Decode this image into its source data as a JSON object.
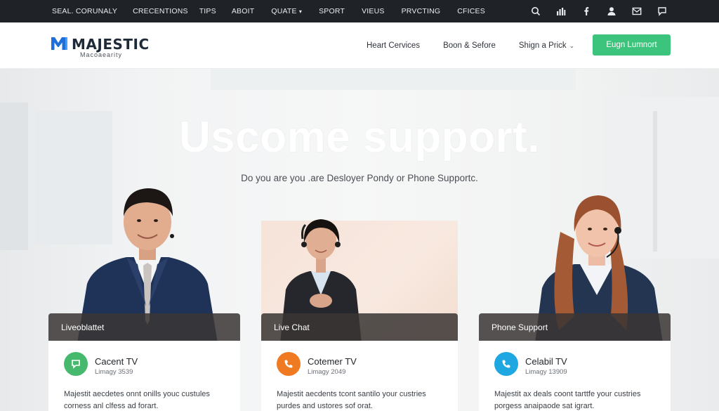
{
  "topbar": {
    "nav": [
      "SEAL. CORUNALY",
      "CRECENTIONS",
      "TIPS",
      "ABOIT",
      "QUATE",
      "SPORT",
      "VIEUS",
      "PRVCTING",
      "CFICES"
    ],
    "dropdown_item": "QUATE",
    "icons": [
      "search-icon",
      "bar-chart-icon",
      "facebook-icon",
      "user-icon",
      "mail-icon",
      "chat-icon"
    ]
  },
  "header": {
    "logo_word": "MAJESTIC",
    "logo_sub": "Macoaearity",
    "nav": [
      {
        "label": "Heart Cervices",
        "dropdown": false
      },
      {
        "label": "Boon & Sefore",
        "dropdown": false
      },
      {
        "label": "Shign a Prick",
        "dropdown": true
      }
    ],
    "cta_label": "Eugn Lumnort"
  },
  "hero": {
    "title": "Uscome support.",
    "subtitle": "Do you are you .are Desloyer Pondy or Phone Supportc."
  },
  "cards": [
    {
      "header": "Liveoblattet",
      "title": "Cacent TV",
      "meta": "Limagy 3539",
      "desc": "Majestit aecdetes onnt onills youc custules corness anl clfess ad forart.",
      "icon": "chat-bubble-icon",
      "color": "#46b96f"
    },
    {
      "header": "Live Chat",
      "title": "Cotemer TV",
      "meta": "Limagy 2049",
      "desc": "Majestit aecdents tcont santilo your custries purdes and ustores sof orat.",
      "icon": "phone-icon",
      "color": "#f07a22"
    },
    {
      "header": "Phone Support",
      "title": "Celabil TV",
      "meta": "Limagy 13909",
      "desc": "Majestit ax deals coont tarttfe your custries porgess anaipaode sat igrart.",
      "icon": "phone-icon",
      "color": "#1fa7e1"
    }
  ],
  "colors": {
    "accent_green": "#3cc47c",
    "topbar": "#1f2328"
  }
}
